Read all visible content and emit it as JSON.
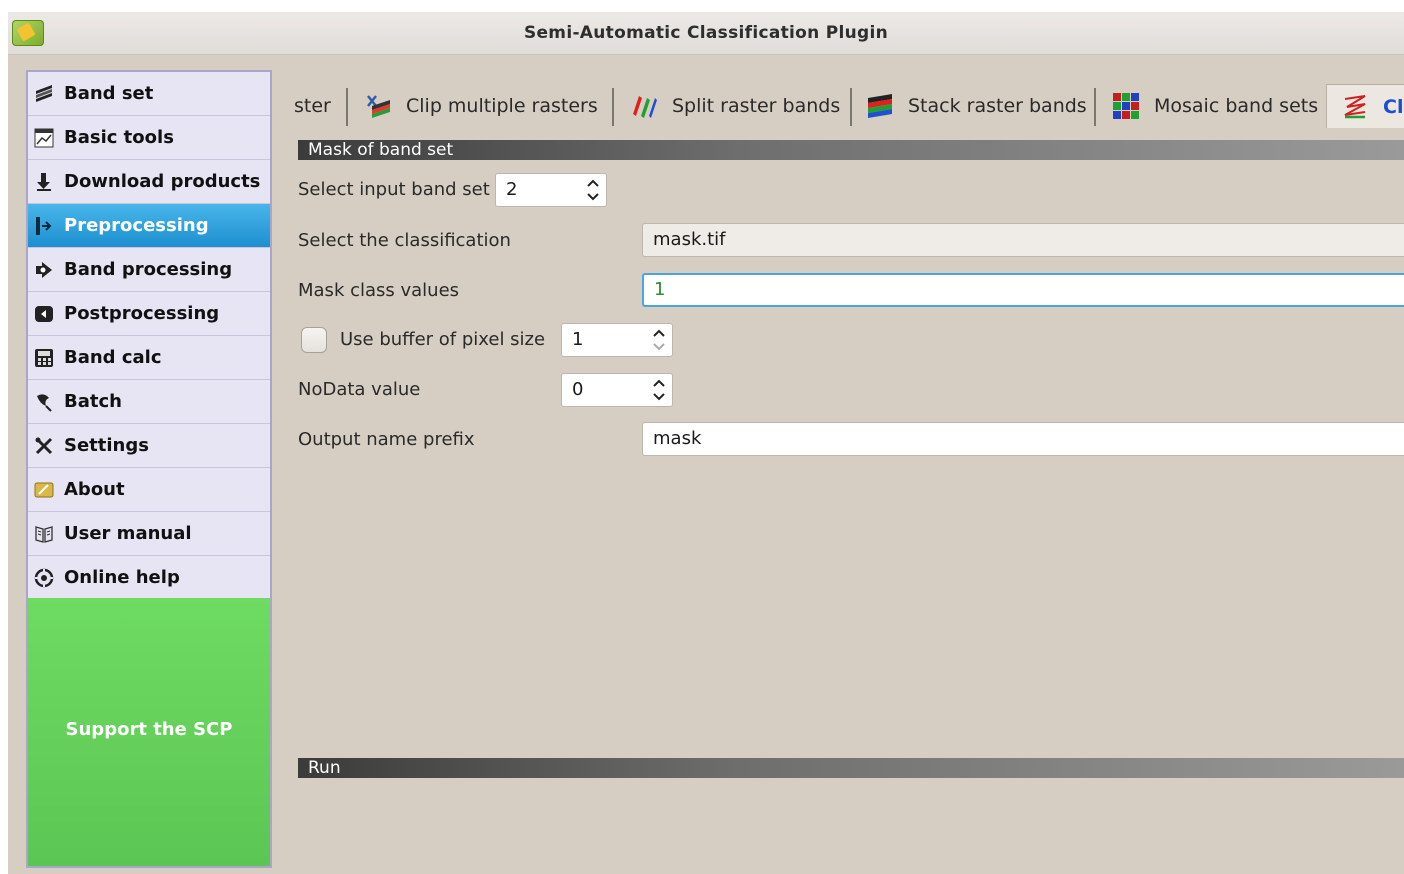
{
  "window": {
    "title": "Semi-Automatic Classification Plugin"
  },
  "sidebar": {
    "items": [
      {
        "label": "Band set",
        "icon": "band-set-icon"
      },
      {
        "label": "Basic tools",
        "icon": "basic-tools-icon"
      },
      {
        "label": "Download products",
        "icon": "download-icon"
      },
      {
        "label": "Preprocessing",
        "icon": "preprocessing-icon",
        "active": true
      },
      {
        "label": "Band processing",
        "icon": "band-processing-icon"
      },
      {
        "label": "Postprocessing",
        "icon": "postprocessing-icon"
      },
      {
        "label": "Band calc",
        "icon": "calculator-icon"
      },
      {
        "label": "Batch",
        "icon": "batch-icon"
      },
      {
        "label": "Settings",
        "icon": "settings-icon"
      },
      {
        "label": "About",
        "icon": "about-icon"
      },
      {
        "label": "User manual",
        "icon": "book-icon"
      },
      {
        "label": "Online help",
        "icon": "help-icon"
      }
    ],
    "support_label": "Support the SCP"
  },
  "tabs": [
    {
      "label": "ster"
    },
    {
      "label": "Clip multiple rasters",
      "icon": "clip-icon"
    },
    {
      "label": "Split raster bands",
      "icon": "split-icon"
    },
    {
      "label": "Stack raster bands",
      "icon": "stack-icon"
    },
    {
      "label": "Mosaic band sets",
      "icon": "mosaic-icon"
    },
    {
      "label": "Clo",
      "icon": "cloud-mask-icon",
      "active": true
    }
  ],
  "mask_section": {
    "header": "Mask of band set",
    "input_band_set_label": "Select input band set",
    "input_band_set_value": "2",
    "classification_label": "Select the classification",
    "classification_value": "mask.tif",
    "mask_values_label": "Mask class values",
    "mask_values_value": "1",
    "buffer_label": "Use buffer of pixel size",
    "buffer_checked": false,
    "buffer_value": "1",
    "nodata_label": "NoData value",
    "nodata_value": "0",
    "prefix_label": "Output name prefix",
    "prefix_value": "mask"
  },
  "run_section": {
    "header": "Run"
  },
  "colors": {
    "active_item": "#2a9fe0",
    "support": "#62cf5a",
    "tab_active_text": "#1b4fd1",
    "focus_border": "#49a6d8"
  }
}
